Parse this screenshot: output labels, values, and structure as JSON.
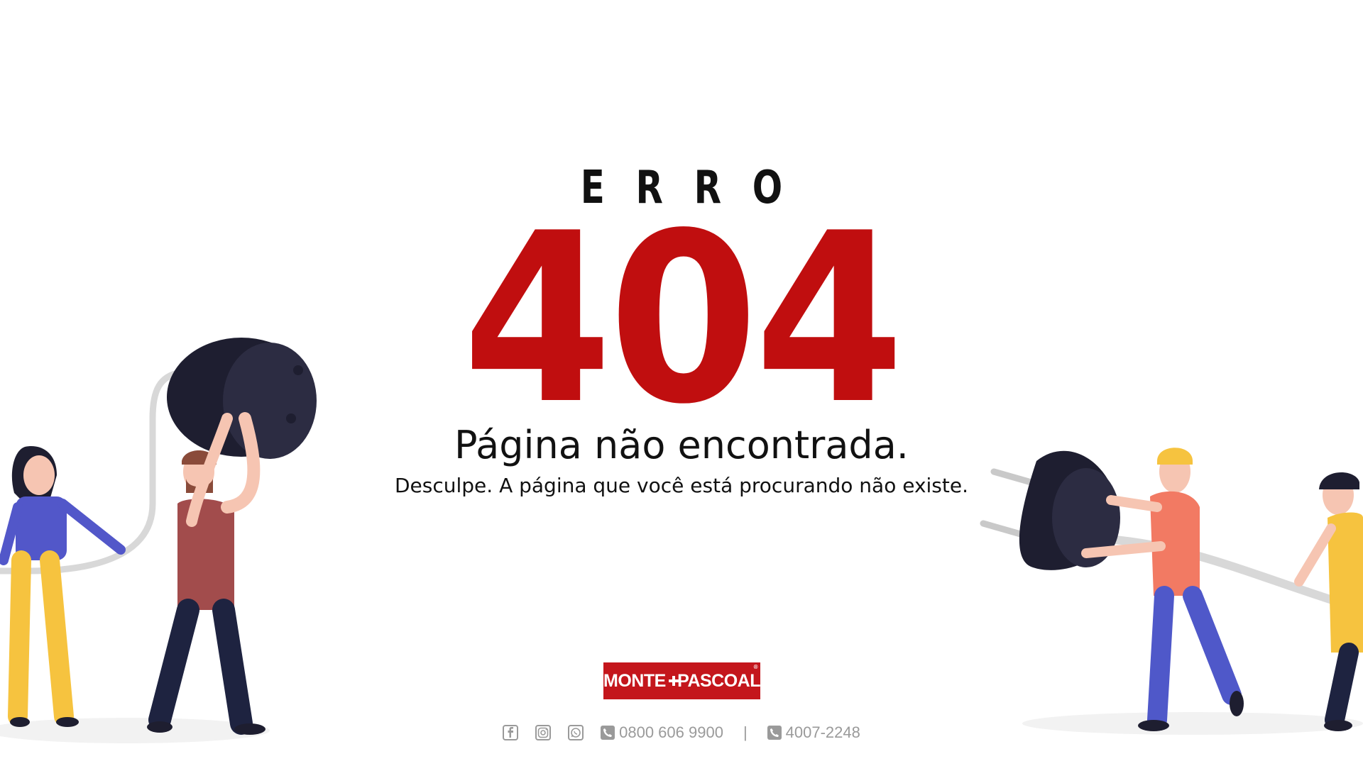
{
  "heading": {
    "erro": "ERRO",
    "code": "404"
  },
  "message": {
    "title": "Página não encontrada.",
    "subtitle": "Desculpe. A página que você está procurando não existe."
  },
  "brand": {
    "left": "MONTE",
    "right": "PASCOAL",
    "registered": "®",
    "color": "#c4161c"
  },
  "footer": {
    "icons": [
      "facebook-icon",
      "instagram-icon",
      "whatsapp-icon"
    ],
    "phone1": "0800 606 9900",
    "separator": "|",
    "phone2": "4007-2248",
    "color": "#9a9a9a"
  },
  "colors": {
    "accent": "#c00e0f",
    "text": "#111111"
  }
}
